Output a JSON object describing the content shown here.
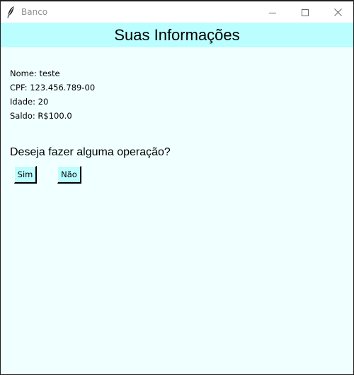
{
  "window": {
    "title": "Banco",
    "icon": "feather-icon",
    "controls": [
      "minimize-icon",
      "maximize-icon",
      "close-icon"
    ]
  },
  "header": {
    "title": "Suas Informações"
  },
  "info": {
    "name": "Nome: teste",
    "cpf": "CPF: 123.456.789-00",
    "age": "Idade: 20",
    "balance": "Saldo: R$100.0"
  },
  "prompt": {
    "question": "Deseja fazer alguma operação?",
    "yes_label": "Sim",
    "no_label": "Não"
  },
  "colors": {
    "background": "#f0ffff",
    "accent": "#bbfeff",
    "title_text": "#8f8f8f"
  }
}
